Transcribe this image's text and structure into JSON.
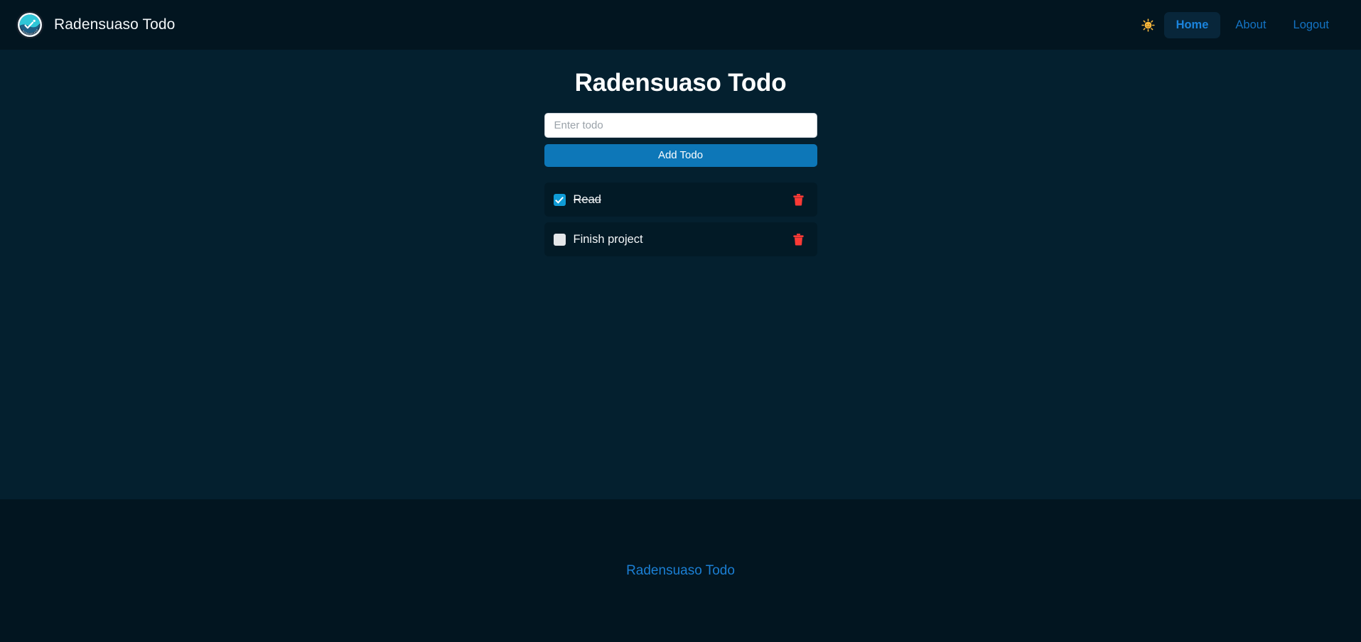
{
  "navbar": {
    "brand_label": "Radensuaso Todo",
    "logo_icon": "wave-check-logo-icon",
    "theme_toggle_icon": "sun-icon",
    "theme_toggle_glyph": "☀",
    "links": [
      {
        "label": "Home",
        "active": true
      },
      {
        "label": "About",
        "active": false
      },
      {
        "label": "Logout",
        "active": false
      }
    ]
  },
  "main": {
    "title": "Radensuaso Todo",
    "input": {
      "placeholder": "Enter todo",
      "value": ""
    },
    "add_button_label": "Add Todo",
    "todos": [
      {
        "label": "Read",
        "checked": true,
        "delete_icon": "trash-icon"
      },
      {
        "label": "Finish project",
        "checked": false,
        "delete_icon": "trash-icon"
      }
    ]
  },
  "footer": {
    "link_label": "Radensuaso Todo"
  },
  "colors": {
    "page_background": "#04202f",
    "bar_background": "#021520",
    "accent_blue": "#0d77b8",
    "link_blue": "#1474c4",
    "checkbox_checked": "#0f9cd7",
    "delete_red": "#fc3a36",
    "sun_orange": "#f5a623"
  }
}
